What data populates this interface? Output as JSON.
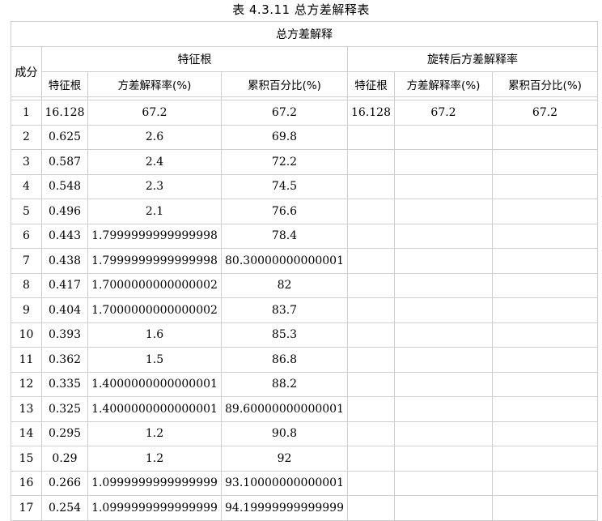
{
  "caption": "表 4.3.11  总方差解释表",
  "headers": {
    "group_title": "总方差解释",
    "component": "成分",
    "initial_group": "特征根",
    "rotated_group": "旋转后方差解释率",
    "eigen": "特征根",
    "variance": "方差解释率(%)",
    "cumulative": "累积百分比(%)",
    "r_eigen": "特征根",
    "r_variance": "方差解释率(%)",
    "r_cumulative": "累积百分比(%)"
  },
  "rows": [
    {
      "c": "1",
      "e": "16.128",
      "v": "67.2",
      "cum": "67.2",
      "re": "16.128",
      "rv": "67.2",
      "rcum": "67.2"
    },
    {
      "c": "2",
      "e": "0.625",
      "v": "2.6",
      "cum": "69.8",
      "re": "",
      "rv": "",
      "rcum": ""
    },
    {
      "c": "3",
      "e": "0.587",
      "v": "2.4",
      "cum": "72.2",
      "re": "",
      "rv": "",
      "rcum": ""
    },
    {
      "c": "4",
      "e": "0.548",
      "v": "2.3",
      "cum": "74.5",
      "re": "",
      "rv": "",
      "rcum": ""
    },
    {
      "c": "5",
      "e": "0.496",
      "v": "2.1",
      "cum": "76.6",
      "re": "",
      "rv": "",
      "rcum": ""
    },
    {
      "c": "6",
      "e": "0.443",
      "v": "1.7999999999999998",
      "cum": "78.4",
      "re": "",
      "rv": "",
      "rcum": ""
    },
    {
      "c": "7",
      "e": "0.438",
      "v": "1.7999999999999998",
      "cum": "80.30000000000001",
      "re": "",
      "rv": "",
      "rcum": ""
    },
    {
      "c": "8",
      "e": "0.417",
      "v": "1.7000000000000002",
      "cum": "82",
      "re": "",
      "rv": "",
      "rcum": ""
    },
    {
      "c": "9",
      "e": "0.404",
      "v": "1.7000000000000002",
      "cum": "83.7",
      "re": "",
      "rv": "",
      "rcum": ""
    },
    {
      "c": "10",
      "e": "0.393",
      "v": "1.6",
      "cum": "85.3",
      "re": "",
      "rv": "",
      "rcum": ""
    },
    {
      "c": "11",
      "e": "0.362",
      "v": "1.5",
      "cum": "86.8",
      "re": "",
      "rv": "",
      "rcum": ""
    },
    {
      "c": "12",
      "e": "0.335",
      "v": "1.4000000000000001",
      "cum": "88.2",
      "re": "",
      "rv": "",
      "rcum": ""
    },
    {
      "c": "13",
      "e": "0.325",
      "v": "1.4000000000000001",
      "cum": "89.60000000000001",
      "re": "",
      "rv": "",
      "rcum": ""
    },
    {
      "c": "14",
      "e": "0.295",
      "v": "1.2",
      "cum": "90.8",
      "re": "",
      "rv": "",
      "rcum": ""
    },
    {
      "c": "15",
      "e": "0.29",
      "v": "1.2",
      "cum": "92",
      "re": "",
      "rv": "",
      "rcum": ""
    },
    {
      "c": "16",
      "e": "0.266",
      "v": "1.0999999999999999",
      "cum": "93.10000000000001",
      "re": "",
      "rv": "",
      "rcum": ""
    },
    {
      "c": "17",
      "e": "0.254",
      "v": "1.0999999999999999",
      "cum": "94.19999999999999",
      "re": "",
      "rv": "",
      "rcum": ""
    }
  ]
}
